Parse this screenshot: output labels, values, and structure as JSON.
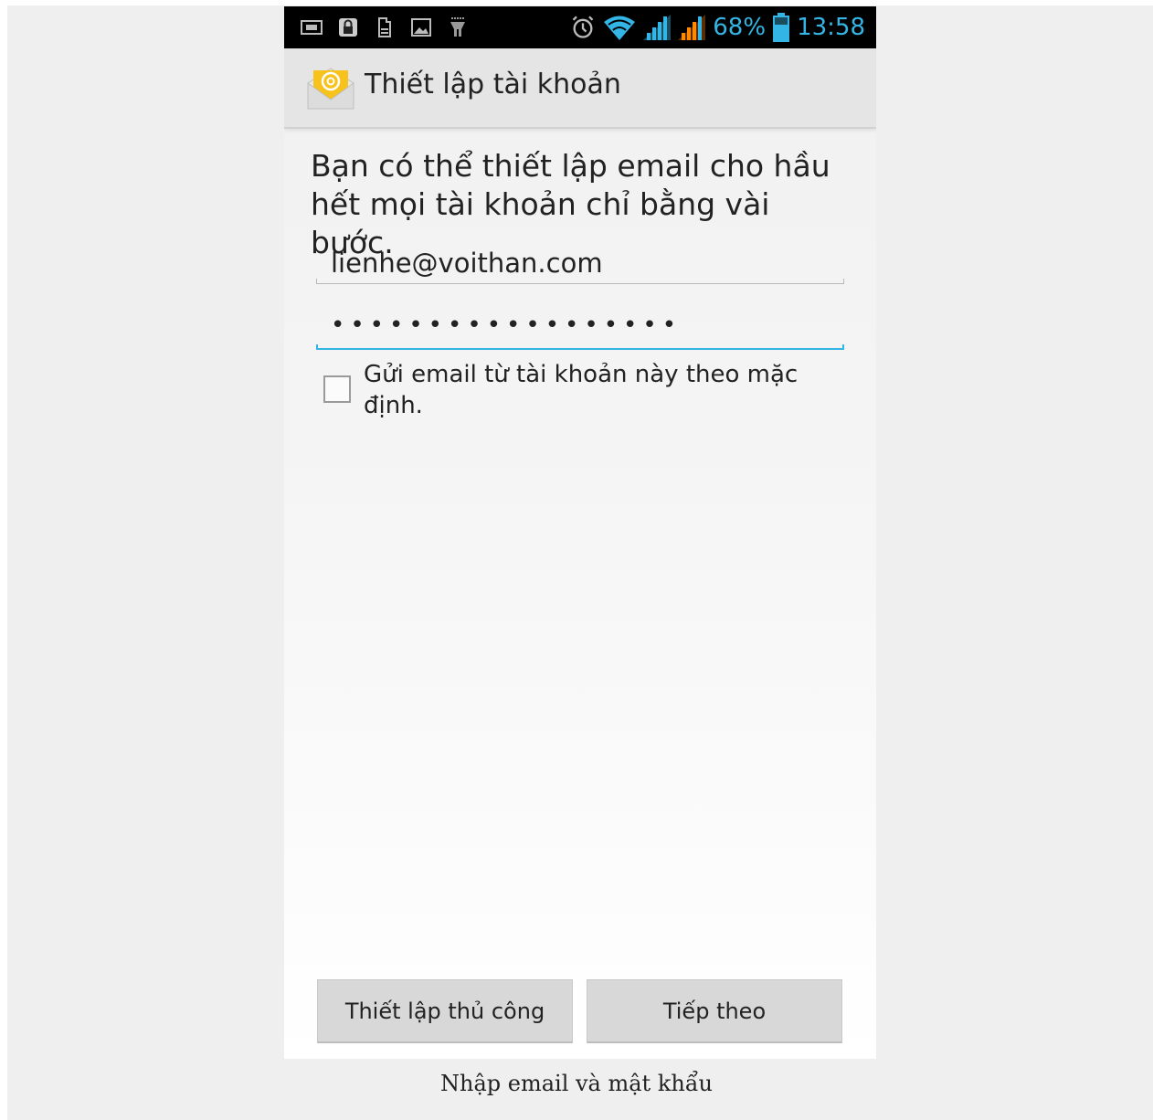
{
  "status_bar": {
    "left_icons": [
      "sim-icon",
      "lock-icon",
      "storage-icon",
      "picture-icon",
      "debug-icon"
    ],
    "right_icons": [
      "alarm-icon",
      "wifi-icon",
      "signal-1-icon",
      "signal-2-icon",
      "battery-icon"
    ],
    "battery_percent": "68%",
    "time": "13:58",
    "accent_color": "#33b5e5"
  },
  "action_bar": {
    "title": "Thiết lập tài khoản",
    "icon": "email-app-icon"
  },
  "form": {
    "intro": "Bạn có thể thiết lập email cho hầu hết mọi tài khoản chỉ bằng vài bước.",
    "email_value": "lienhe@voithan.com",
    "password_mask": "••••••••••••••••••",
    "default_checkbox_label": "Gửi email từ tài khoản này theo mặc định.",
    "default_checked": false
  },
  "buttons": {
    "manual_setup": "Thiết lập thủ công",
    "next": "Tiếp theo"
  },
  "caption": "Nhập email và mật khẩu"
}
